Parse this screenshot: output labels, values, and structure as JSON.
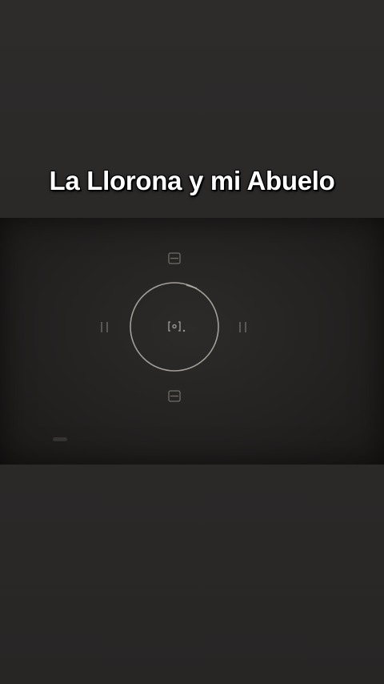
{
  "video": {
    "caption": "La Llorona y mi Abuelo"
  },
  "colors": {
    "background": "#2b2928",
    "video_frame": "#242221",
    "caption_text": "#ffffff",
    "reticle": "#b8b4ae"
  },
  "icons": {
    "center": "camera-focus-icon",
    "top": "focus-marker-top-icon",
    "bottom": "focus-marker-bottom-icon",
    "left": "focus-marker-left-icon",
    "right": "focus-marker-right-icon"
  }
}
